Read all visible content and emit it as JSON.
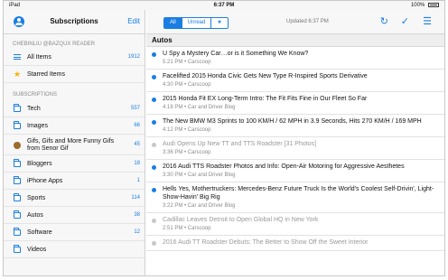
{
  "status_bar": {
    "carrier": "iPad",
    "time": "6:37 PM",
    "battery": "100%"
  },
  "sidebar": {
    "title": "Subscriptions",
    "edit_label": "Edit",
    "account_section": "CHEBINLIU @BAZQUX READER",
    "account_items": [
      {
        "label": "All Items",
        "count": "1912",
        "icon": "all-items-icon"
      },
      {
        "label": "Starred Items",
        "count": "",
        "icon": "star-icon"
      }
    ],
    "subscriptions_section": "SUBSCRIPTIONS",
    "folders": [
      {
        "label": "Tech",
        "count": "557",
        "icon": "folder-icon"
      },
      {
        "label": "Images",
        "count": "66",
        "icon": "folder-icon"
      },
      {
        "label": "Gifs, Gifs and More Funny Gifs from Senor Gif",
        "count": "45",
        "icon": "feed-icon"
      },
      {
        "label": "Bloggers",
        "count": "18",
        "icon": "folder-icon"
      },
      {
        "label": "iPhone Apps",
        "count": "1",
        "icon": "folder-icon"
      },
      {
        "label": "Sports",
        "count": "114",
        "icon": "folder-icon"
      },
      {
        "label": "Autos",
        "count": "38",
        "icon": "folder-icon"
      },
      {
        "label": "Software",
        "count": "12",
        "icon": "folder-icon"
      },
      {
        "label": "Videos",
        "count": "",
        "icon": "folder-icon"
      }
    ]
  },
  "toolbar": {
    "filters": [
      "All",
      "Unread",
      "★"
    ],
    "active_filter": "All",
    "updated": "Updated 6:37 PM",
    "refresh_icon": "refresh-icon",
    "mark_read_icon": "checkmark-icon",
    "list_icon": "list-icon"
  },
  "main": {
    "section": "Autos",
    "articles": [
      {
        "title": "U Spy a Mystery Car…or is it Something We Know?",
        "meta": "5:21 PM • Carscoop",
        "read": false
      },
      {
        "title": "Facelifted 2015 Honda Civic Gets New Type R-Inspired Sports Derivative",
        "meta": "4:30 PM • Carscoop",
        "read": false
      },
      {
        "title": "2015 Honda Fit EX Long-Term Intro: The Fit Fits Fine in Our Fleet So Far",
        "meta": "4:18 PM • Car and Driver Blog",
        "read": false
      },
      {
        "title": "The New BMW M3 Sprints to 100 KM/H / 62 MPH in 3.9 Seconds, Hits 270 KM/H / 169 MPH",
        "meta": "4:12 PM • Carscoop",
        "read": false
      },
      {
        "title": "Audi Opens Up New TT and TTS Roadster [31 Photos]",
        "meta": "3:36 PM • Carscoop",
        "read": true
      },
      {
        "title": "2016 Audi TTS Roadster Photos and Info: Open-Air Motoring for Aggressive Aesthetes",
        "meta": "3:30 PM • Car and Driver Blog",
        "read": false
      },
      {
        "title": "Hells Yes, Mothertruckers: Mercedes-Benz Future Truck Is the World's Coolest Self-Drivin', Light-Show-Havin' Big Rig",
        "meta": "3:22 PM • Car and Driver Blog",
        "read": false
      },
      {
        "title": "Cadillac Leaves Detroit to Open Global HQ in New York",
        "meta": "2:51 PM • Carscoop",
        "read": true
      },
      {
        "title": "2016 Audi TT Roadster Debuts: The Better to Show Off the Sweet Interior",
        "meta": "",
        "read": true
      }
    ]
  },
  "colors": {
    "accent": "#1a7ee2",
    "star": "#f5b400"
  }
}
